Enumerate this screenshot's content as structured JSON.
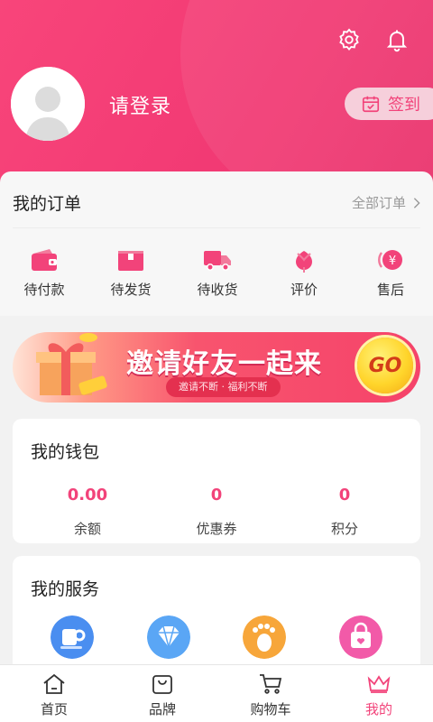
{
  "header": {
    "login_text": "请登录",
    "signin_label": "签到",
    "accent": "#f2437a"
  },
  "orders": {
    "title": "我的订单",
    "all_label": "全部订单",
    "items": [
      {
        "label": "待付款",
        "icon": "wallet-icon"
      },
      {
        "label": "待发货",
        "icon": "package-icon"
      },
      {
        "label": "待收货",
        "icon": "truck-icon"
      },
      {
        "label": "评价",
        "icon": "flower-icon"
      },
      {
        "label": "售后",
        "icon": "refund-icon"
      }
    ]
  },
  "banner": {
    "title": "邀请好友一起来",
    "subtitle": "邀请不断 · 福利不断",
    "go_label": "GO"
  },
  "wallet": {
    "title": "我的钱包",
    "items": [
      {
        "value": "0.00",
        "label": "余额"
      },
      {
        "value": "0",
        "label": "优惠券"
      },
      {
        "value": "0",
        "label": "积分"
      }
    ]
  },
  "services": {
    "title": "我的服务",
    "icons": [
      "cup-icon",
      "diamond-icon",
      "footprint-icon",
      "shopping-bag-icon"
    ]
  },
  "tabbar": {
    "items": [
      {
        "label": "首页",
        "icon": "home-icon"
      },
      {
        "label": "品牌",
        "icon": "bag-icon"
      },
      {
        "label": "购物车",
        "icon": "cart-icon"
      },
      {
        "label": "我的",
        "icon": "crown-icon",
        "active": true
      }
    ]
  }
}
